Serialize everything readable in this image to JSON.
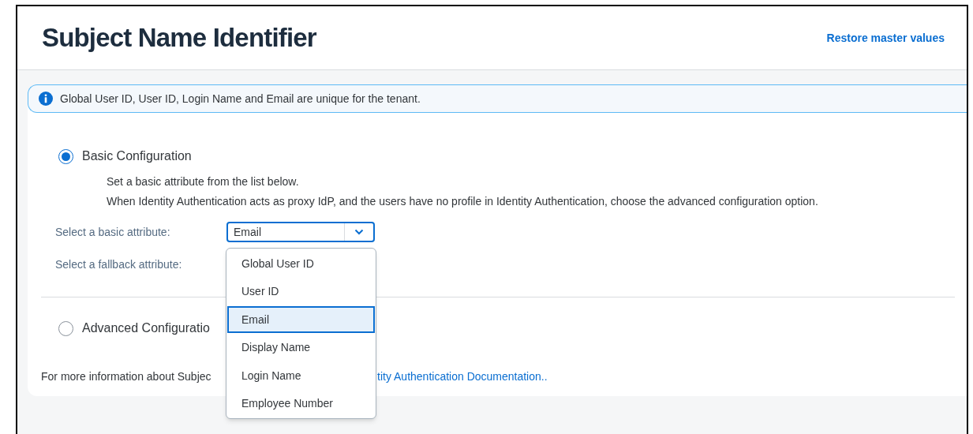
{
  "header": {
    "title": "Subject Name Identifier",
    "restore_link": "Restore master values"
  },
  "info_message": "Global User ID, User ID, Login Name and Email are unique for the tenant.",
  "options": [
    {
      "label": "Basic Configuration",
      "selected": true,
      "description": [
        "Set a basic attribute from the list below.",
        "When Identity Authentication acts as proxy IdP, and the users have no profile in Identity Authentication, choose the advanced configuration option."
      ],
      "fields": [
        {
          "label": "Select a basic attribute:",
          "value": "Email",
          "expanded": true
        },
        {
          "label": "Select a fallback attribute:"
        }
      ]
    },
    {
      "label": "Advanced Configuratio",
      "selected": false
    }
  ],
  "footer": {
    "text": "For more information about Subjec",
    "link": "tity Authentication Documentation.."
  },
  "dropdown_items": [
    {
      "label": "Global User ID",
      "selected": false
    },
    {
      "label": "User ID",
      "selected": false
    },
    {
      "label": "Email",
      "selected": true
    },
    {
      "label": "Display Name",
      "selected": false
    },
    {
      "label": "Login Name",
      "selected": false
    },
    {
      "label": "Employee Number",
      "selected": false
    }
  ]
}
